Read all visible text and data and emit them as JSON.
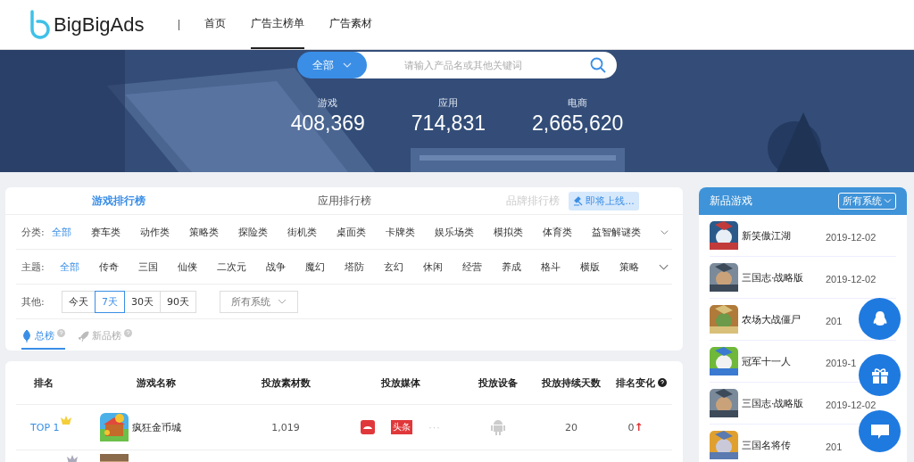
{
  "header": {
    "logo": "BigBigAds",
    "nav": [
      {
        "label": "首页",
        "selected": false
      },
      {
        "label": "广告主榜单",
        "selected": true
      },
      {
        "label": "广告素材",
        "selected": false
      }
    ]
  },
  "hero": {
    "search": {
      "scope": "全部",
      "placeholder": "请输入产品名或其他关键词"
    },
    "stats": [
      {
        "label": "游戏",
        "value": "408,369"
      },
      {
        "label": "应用",
        "value": "714,831"
      },
      {
        "label": "电商",
        "value": "2,665,620"
      }
    ]
  },
  "rank_tabs": [
    {
      "label": "游戏排行榜",
      "selected": true,
      "disabled": false
    },
    {
      "label": "应用排行榜",
      "selected": false,
      "disabled": false
    },
    {
      "label": "品牌排行榜",
      "selected": false,
      "disabled": true,
      "badge": "即将上线..."
    }
  ],
  "filters": [
    {
      "label": "分类:",
      "options": [
        {
          "label": "全部",
          "selected": true
        },
        {
          "label": "赛车类",
          "selected": false
        },
        {
          "label": "动作类",
          "selected": false
        },
        {
          "label": "策略类",
          "selected": false
        },
        {
          "label": "探险类",
          "selected": false
        },
        {
          "label": "街机类",
          "selected": false
        },
        {
          "label": "桌面类",
          "selected": false
        },
        {
          "label": "卡牌类",
          "selected": false
        },
        {
          "label": "娱乐场类",
          "selected": false
        },
        {
          "label": "模拟类",
          "selected": false
        },
        {
          "label": "体育类",
          "selected": false
        },
        {
          "label": "益智解谜类",
          "selected": false
        }
      ]
    },
    {
      "label": "主题:",
      "options": [
        {
          "label": "全部",
          "selected": true
        },
        {
          "label": "传奇",
          "selected": false
        },
        {
          "label": "三国",
          "selected": false
        },
        {
          "label": "仙侠",
          "selected": false
        },
        {
          "label": "二次元",
          "selected": false
        },
        {
          "label": "战争",
          "selected": false
        },
        {
          "label": "魔幻",
          "selected": false
        },
        {
          "label": "塔防",
          "selected": false
        },
        {
          "label": "玄幻",
          "selected": false
        },
        {
          "label": "休闲",
          "selected": false
        },
        {
          "label": "经营",
          "selected": false
        },
        {
          "label": "养成",
          "selected": false
        },
        {
          "label": "格斗",
          "selected": false
        },
        {
          "label": "横版",
          "selected": false
        },
        {
          "label": "策略",
          "selected": false
        }
      ]
    }
  ],
  "other": {
    "label": "其他:",
    "periods": [
      {
        "label": "今天",
        "selected": false
      },
      {
        "label": "7天",
        "selected": true
      },
      {
        "label": "30天",
        "selected": false
      },
      {
        "label": "90天",
        "selected": false
      }
    ],
    "system": "所有系统"
  },
  "list_tabs": [
    {
      "label": "总榜",
      "selected": true
    },
    {
      "label": "新品榜",
      "selected": false
    }
  ],
  "table": {
    "columns": [
      "排名",
      "游戏名称",
      "投放素材数",
      "投放媒体",
      "投放设备",
      "投放持续天数",
      "排名变化"
    ],
    "rows": [
      {
        "rank": "TOP 1",
        "name": "疯狂金币城",
        "materials": "1,019",
        "media_badge": "头条",
        "more": "···",
        "days": "20",
        "change": "0",
        "arrow": "↑"
      }
    ]
  },
  "new_games": {
    "title": "新品游戏",
    "system": "所有系统",
    "items": [
      {
        "name": "新笑傲江湖",
        "date": "2019-12-02"
      },
      {
        "name": "三国志·战略版",
        "date": "2019-12-02"
      },
      {
        "name": "农场大战僵尸",
        "date": "201"
      },
      {
        "name": "冠军十一人",
        "date": "2019-1"
      },
      {
        "name": "三国志·战略版",
        "date": "2019-12-02"
      },
      {
        "name": "三国名将传",
        "date": "201"
      }
    ]
  }
}
